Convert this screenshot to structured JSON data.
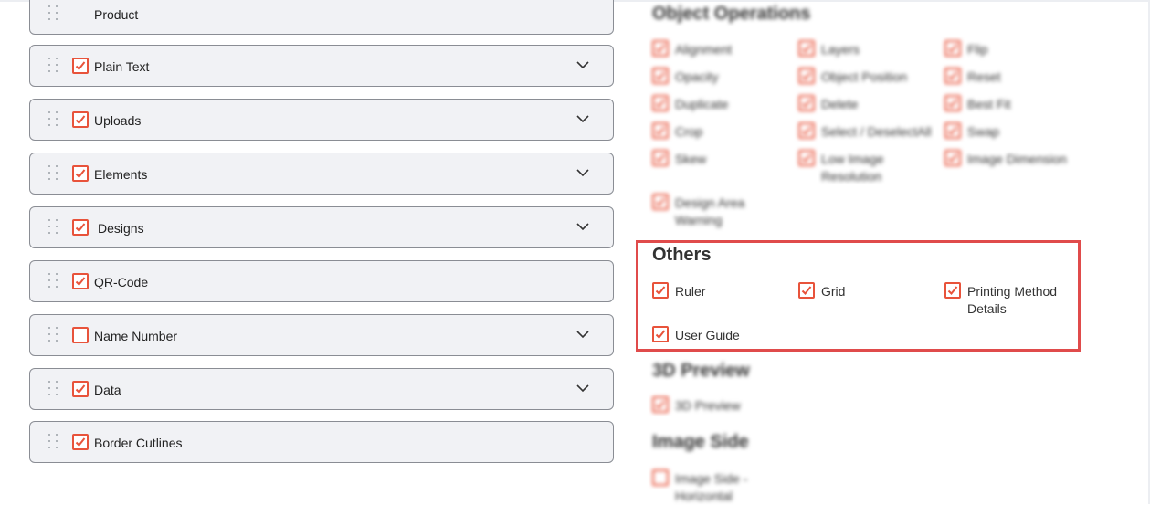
{
  "left_panel": {
    "rows": [
      {
        "label": "Product",
        "checked": null,
        "has_chevron": false
      },
      {
        "label": "Plain Text",
        "checked": true,
        "has_chevron": true
      },
      {
        "label": "Uploads",
        "checked": true,
        "has_chevron": true
      },
      {
        "label": "Elements",
        "checked": true,
        "has_chevron": true
      },
      {
        "label": "Designs",
        "checked": true,
        "has_chevron": true
      },
      {
        "label": "QR-Code",
        "checked": true,
        "has_chevron": false
      },
      {
        "label": "Name Number",
        "checked": false,
        "has_chevron": true
      },
      {
        "label": "Data",
        "checked": true,
        "has_chevron": true
      },
      {
        "label": "Border Cutlines",
        "checked": true,
        "has_chevron": false
      }
    ]
  },
  "object_operations": {
    "title": "Object Operations",
    "items": [
      {
        "label": "Alignment",
        "checked": true
      },
      {
        "label": "Layers",
        "checked": true
      },
      {
        "label": "Flip",
        "checked": true
      },
      {
        "label": "Opacity",
        "checked": true
      },
      {
        "label": "Object Position",
        "checked": true
      },
      {
        "label": "Reset",
        "checked": true
      },
      {
        "label": "Duplicate",
        "checked": true
      },
      {
        "label": "Delete",
        "checked": true
      },
      {
        "label": "Best Fit",
        "checked": true
      },
      {
        "label": "Crop",
        "checked": true
      },
      {
        "label": "Select / DeselectAll",
        "checked": true
      },
      {
        "label": "Swap",
        "checked": true
      },
      {
        "label": "Skew",
        "checked": true
      },
      {
        "label": "Low Image Resolution",
        "checked": true
      },
      {
        "label": "Image Dimension",
        "checked": true
      },
      {
        "label": "Design Area Warning",
        "checked": true
      }
    ]
  },
  "others": {
    "title": "Others",
    "items": [
      {
        "label": "Ruler",
        "checked": true
      },
      {
        "label": "Grid",
        "checked": true
      },
      {
        "label": "Printing Method Details",
        "checked": true
      },
      {
        "label": "User Guide",
        "checked": true
      }
    ]
  },
  "preview_3d": {
    "title": "3D Preview",
    "items": [
      {
        "label": "3D Preview",
        "checked": true
      }
    ]
  },
  "image_side": {
    "title": "Image Side",
    "items": [
      {
        "label": "Image Side - Horizontal",
        "checked": false
      }
    ]
  },
  "colors": {
    "accent": "#e8533b",
    "highlight_border": "#e04b4b",
    "row_bg": "#f1f2f5"
  }
}
